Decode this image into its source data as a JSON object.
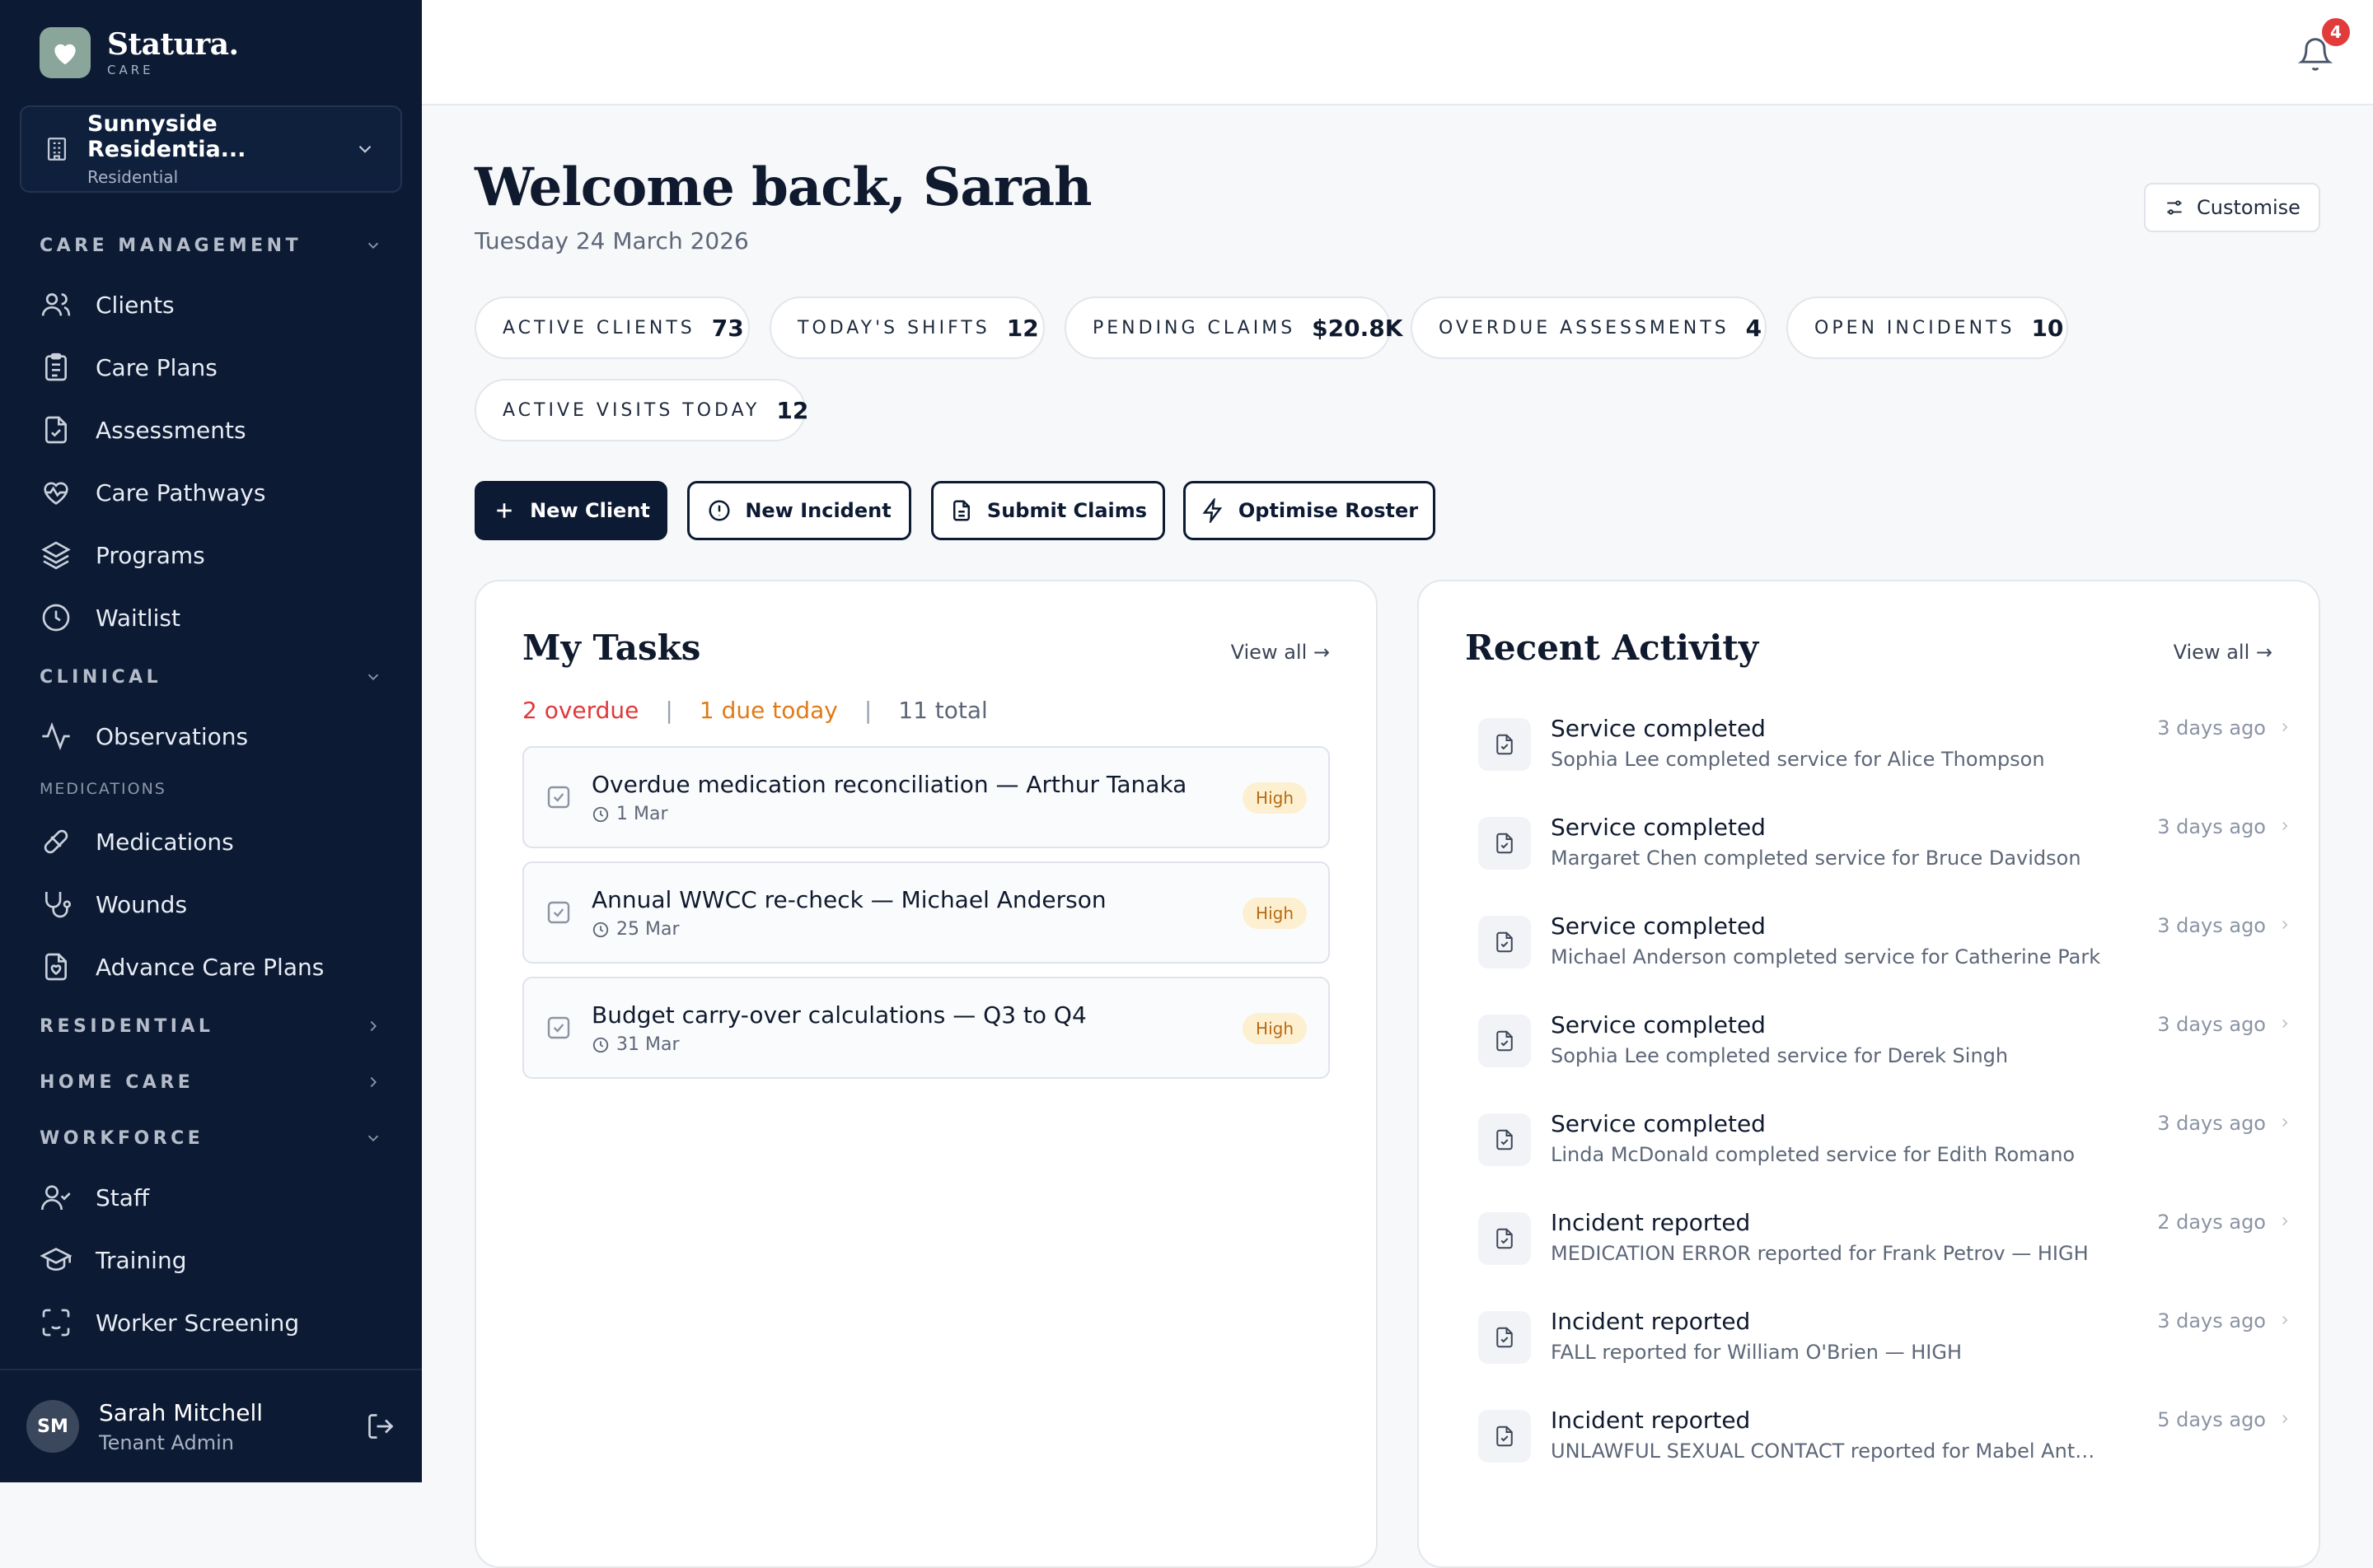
{
  "brand": {
    "name": "Statura.",
    "sub": "CARE"
  },
  "tenant": {
    "name": "Sunnyside Residentia...",
    "type": "Residential"
  },
  "nav": {
    "care_management": "CARE MANAGEMENT",
    "clients": "Clients",
    "care_plans": "Care Plans",
    "assessments": "Assessments",
    "care_pathways": "Care Pathways",
    "programs": "Programs",
    "waitlist": "Waitlist",
    "clinical": "CLINICAL",
    "observations": "Observations",
    "medications_header": "MEDICATIONS",
    "medications": "Medications",
    "wounds": "Wounds",
    "advance_care_plans": "Advance Care Plans",
    "residential": "RESIDENTIAL",
    "home_care": "HOME CARE",
    "workforce": "WORKFORCE",
    "staff": "Staff",
    "training": "Training",
    "worker_screening": "Worker Screening"
  },
  "user": {
    "initials": "SM",
    "name": "Sarah Mitchell",
    "role": "Tenant Admin"
  },
  "notifications": {
    "count": "4"
  },
  "header": {
    "welcome": "Welcome back, Sarah",
    "date": "Tuesday 24 March 2026",
    "customise": "Customise"
  },
  "stats": [
    {
      "label": "ACTIVE CLIENTS",
      "value": "73"
    },
    {
      "label": "TODAY'S SHIFTS",
      "value": "12"
    },
    {
      "label": "PENDING CLAIMS",
      "value": "$20.8K"
    },
    {
      "label": "OVERDUE ASSESSMENTS",
      "value": "4"
    },
    {
      "label": "OPEN INCIDENTS",
      "value": "10"
    },
    {
      "label": "ACTIVE VISITS TODAY",
      "value": "12"
    }
  ],
  "actions": {
    "new_client": "New Client",
    "new_incident": "New Incident",
    "submit_claims": "Submit Claims",
    "optimise_roster": "Optimise Roster"
  },
  "tasks": {
    "title": "My Tasks",
    "view_all": "View all →",
    "overdue": "2 overdue",
    "due_today": "1 due today",
    "total": "11 total",
    "separator": "|",
    "items": [
      {
        "title": "Overdue medication reconciliation — Arthur Tanaka",
        "date": "1 Mar",
        "priority": "High"
      },
      {
        "title": "Annual WWCC re-check — Michael Anderson",
        "date": "25 Mar",
        "priority": "High"
      },
      {
        "title": "Budget carry-over calculations — Q3 to Q4",
        "date": "31 Mar",
        "priority": "High"
      }
    ]
  },
  "activity": {
    "title": "Recent Activity",
    "view_all": "View all →",
    "items": [
      {
        "title": "Service completed",
        "desc": "Sophia Lee completed service for Alice Thompson",
        "time": "3 days ago"
      },
      {
        "title": "Service completed",
        "desc": "Margaret Chen completed service for Bruce Davidson",
        "time": "3 days ago"
      },
      {
        "title": "Service completed",
        "desc": "Michael Anderson completed service for Catherine Park",
        "time": "3 days ago"
      },
      {
        "title": "Service completed",
        "desc": "Sophia Lee completed service for Derek Singh",
        "time": "3 days ago"
      },
      {
        "title": "Service completed",
        "desc": "Linda McDonald completed service for Edith Romano",
        "time": "3 days ago"
      },
      {
        "title": "Incident reported",
        "desc": "MEDICATION ERROR reported for Frank Petrov — HIGH",
        "time": "2 days ago"
      },
      {
        "title": "Incident reported",
        "desc": "FALL reported for William O'Brien — HIGH",
        "time": "3 days ago"
      },
      {
        "title": "Incident reported",
        "desc": "UNLAWFUL SEXUAL CONTACT reported for Mabel Antonop...",
        "time": "5 days ago"
      }
    ]
  }
}
